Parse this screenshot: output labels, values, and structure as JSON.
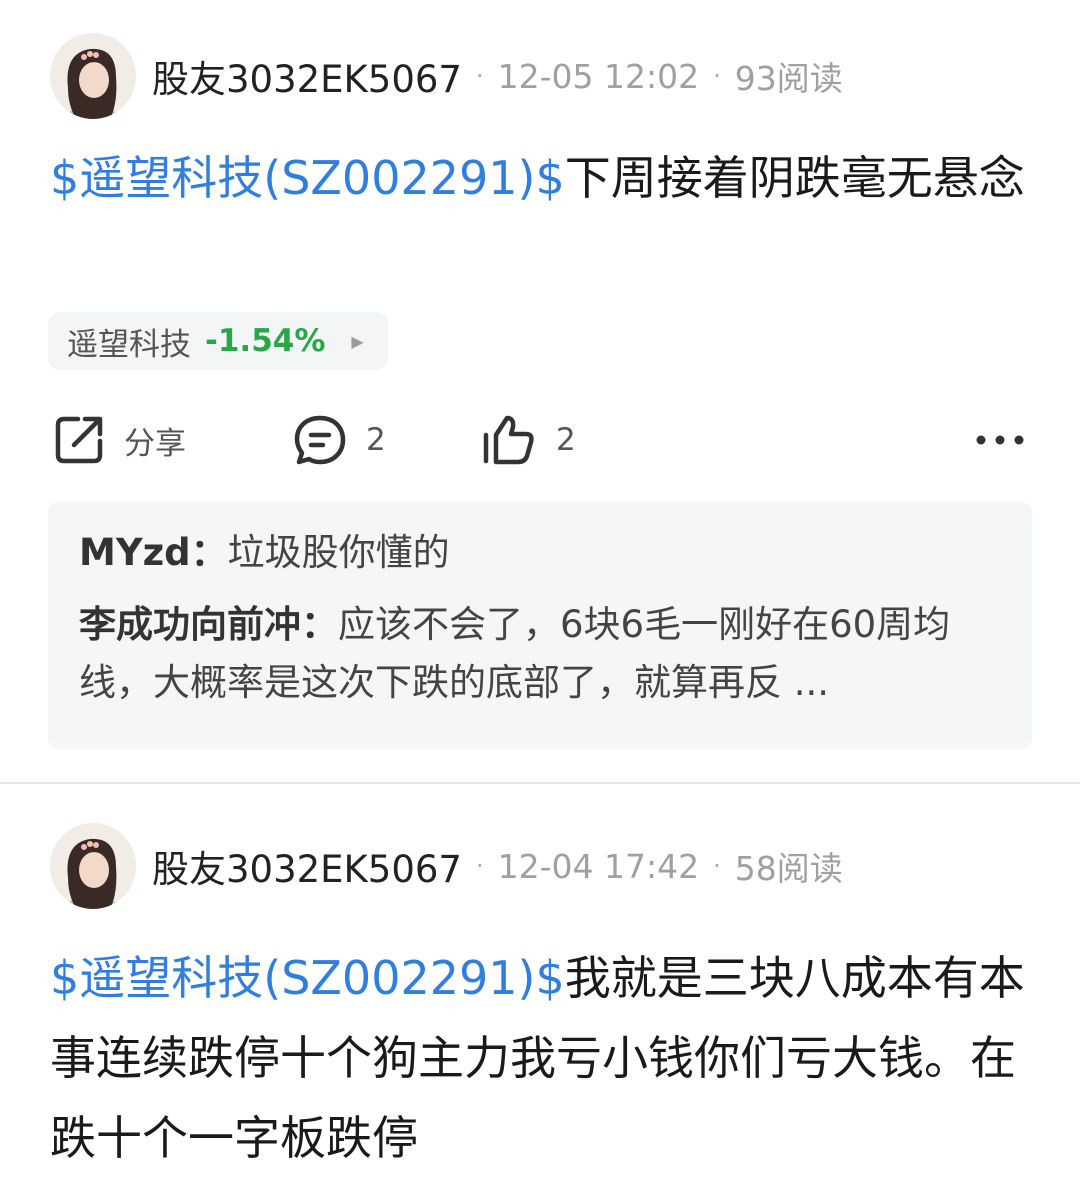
{
  "posts": [
    {
      "author": "股友3032EK5067",
      "date": "12-05 12:02",
      "reads": "93阅读",
      "tag": "$遥望科技(SZ002291)$",
      "text": "下周接着阴跌毫无悬念",
      "stock": {
        "name": "遥望科技",
        "change": "-1.54%"
      },
      "actions": {
        "share_label": "分享",
        "comment_count": "2",
        "like_count": "2"
      },
      "comments": [
        {
          "author": "MYzd：",
          "text": "垃圾股你懂的"
        },
        {
          "author": "李成功向前冲：",
          "text": "应该不会了，6块6毛一刚好在60周均线，大概率是这次下跌的底部了，就算再反 ..."
        }
      ]
    },
    {
      "author": "股友3032EK5067",
      "date": "12-04 17:42",
      "reads": "58阅读",
      "tag": "$遥望科技(SZ002291)$",
      "text": "我就是三块八成本有本事连续跌停十个狗主力我亏小钱你们亏大钱。在跌十个一字板跌停"
    }
  ],
  "colors": {
    "accent": "#2f7ee0",
    "down": "#27a745"
  },
  "icons": {
    "share": "share-icon",
    "comment": "comment-icon",
    "like": "thumbs-up-icon",
    "more": "more-icon"
  }
}
